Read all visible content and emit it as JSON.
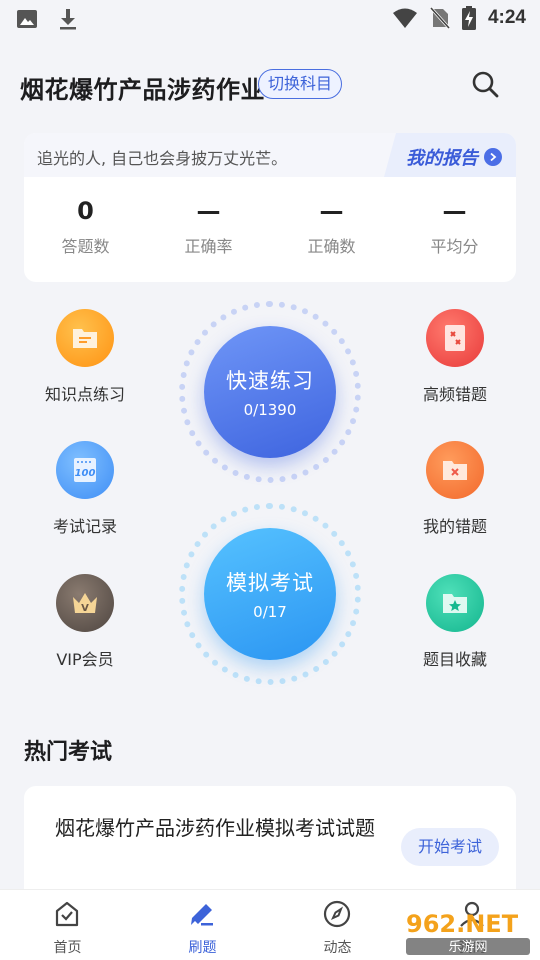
{
  "status": {
    "time": "4:24"
  },
  "header": {
    "title": "烟花爆竹产品涉药作业",
    "switch_label": "切换科目"
  },
  "report": {
    "motto": "追光的人, 自己也会身披万丈光芒。",
    "link_label": "我的报告",
    "stats": [
      {
        "value": "0",
        "label": "答题数"
      },
      {
        "value": "—",
        "label": "正确率"
      },
      {
        "value": "—",
        "label": "正确数"
      },
      {
        "value": "—",
        "label": "平均分"
      }
    ]
  },
  "features": {
    "knowledge": "知识点练习",
    "frequent_errors": "高频错题",
    "exam_records": "考试记录",
    "my_errors": "我的错题",
    "vip": "VIP会员",
    "favorites": "题目收藏"
  },
  "quick_practice": {
    "title": "快速练习",
    "count": "0/1390"
  },
  "mock_exam": {
    "title": "模拟考试",
    "count": "0/17"
  },
  "hot_exams": {
    "section_title": "热门考试",
    "items": [
      {
        "title": "烟花爆竹产品涉药作业模拟考试试题",
        "button": "开始考试"
      }
    ]
  },
  "nav": [
    {
      "label": "首页",
      "icon": "home-check-icon"
    },
    {
      "label": "刷题",
      "icon": "pen-icon",
      "active": true
    },
    {
      "label": "动态",
      "icon": "compass-icon"
    },
    {
      "label": "我的",
      "icon": "user-icon"
    }
  ],
  "watermark": {
    "main": "962.NET",
    "sub": "乐游网"
  },
  "colors": {
    "accent": "#3d63d9",
    "orange": "#ff9a1f",
    "red": "#f24c4c",
    "green": "#1fc8a0"
  }
}
